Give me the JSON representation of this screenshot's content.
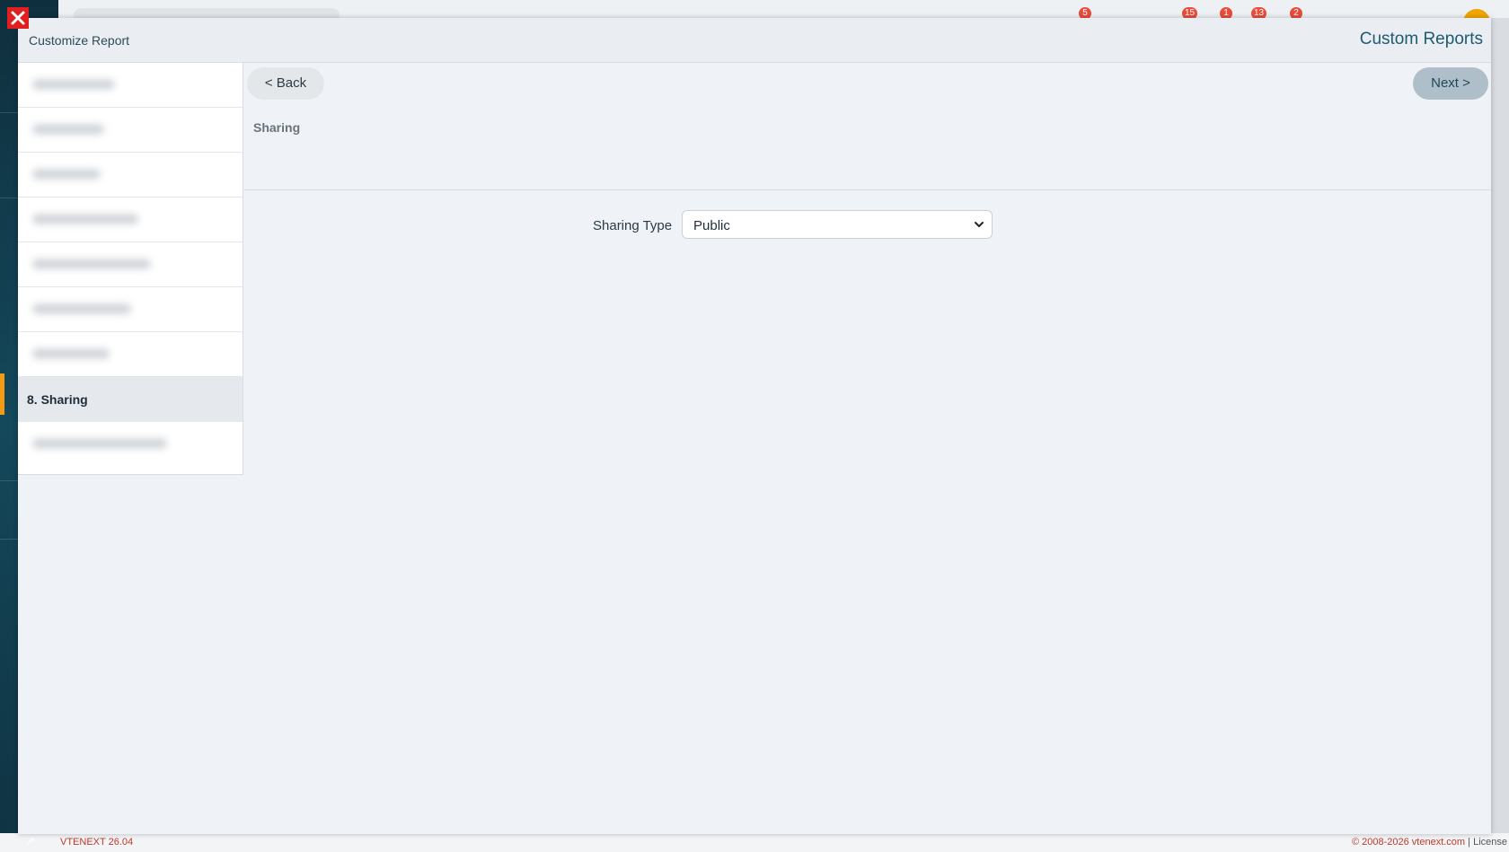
{
  "modal": {
    "title": "Customize Report",
    "header_right": "Custom Reports"
  },
  "steps": {
    "active_label": "8. Sharing"
  },
  "nav": {
    "back_label": "< Back",
    "next_label": "Next >"
  },
  "section": {
    "title": "Sharing"
  },
  "sharing_type": {
    "label": "Sharing Type",
    "value": "Public"
  },
  "top_badges": [
    "5",
    "15",
    "1",
    "13",
    "2"
  ],
  "footer": {
    "version": "VTENEXT 26.04",
    "copyright": "© 2008-2026 vtenext.com",
    "separator": "|",
    "license": "License"
  },
  "colors": {
    "accent": "#f39c12",
    "header_text": "#1f5a73",
    "next_button": "#aebfca",
    "footer_text": "#c0392b"
  }
}
